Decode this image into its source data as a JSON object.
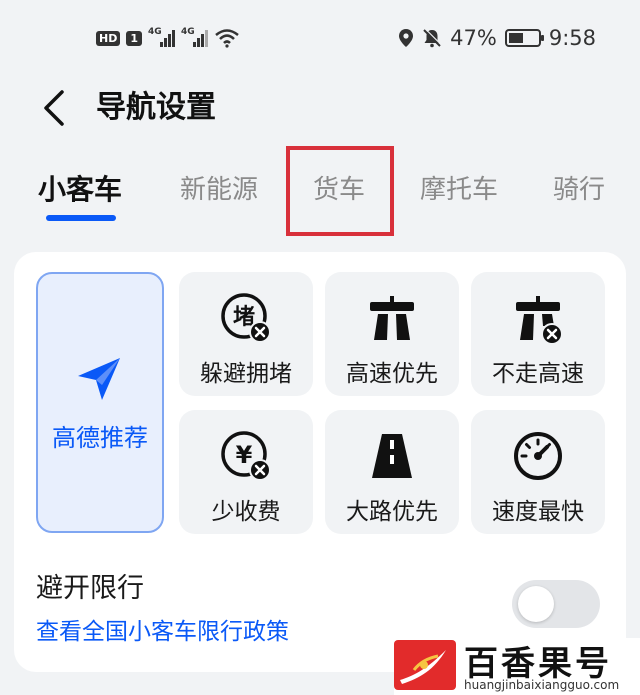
{
  "status_bar": {
    "hd": "HD",
    "sim": "1",
    "net1": "4G",
    "net2": "4G",
    "battery": "47%",
    "time": "9:58"
  },
  "header": {
    "title": "导航设置"
  },
  "tabs": [
    {
      "label": "小客车",
      "active": true
    },
    {
      "label": "新能源",
      "active": false
    },
    {
      "label": "货车",
      "active": false
    },
    {
      "label": "摩托车",
      "active": false
    },
    {
      "label": "骑行",
      "active": false
    }
  ],
  "route_options": {
    "recommended": {
      "label": "高德推荐",
      "icon": "paper-plane-icon",
      "selected": true
    },
    "items": [
      {
        "label": "躲避拥堵",
        "icon": "traffic-jam-icon"
      },
      {
        "label": "高速优先",
        "icon": "highway-icon"
      },
      {
        "label": "不走高速",
        "icon": "no-highway-icon"
      },
      {
        "label": "少收费",
        "icon": "no-toll-icon"
      },
      {
        "label": "大路优先",
        "icon": "main-road-icon"
      },
      {
        "label": "速度最快",
        "icon": "speedometer-icon"
      }
    ]
  },
  "avoid_restriction": {
    "title": "避开限行",
    "link": "查看全国小客车限行政策",
    "toggle_on": false
  },
  "watermark": {
    "name": "百香果号",
    "url": "huangjinbaixiangguo.com"
  },
  "colors": {
    "accent": "#0a59f7",
    "highlight_box": "#d8303a",
    "background": "#f1f3f5"
  }
}
